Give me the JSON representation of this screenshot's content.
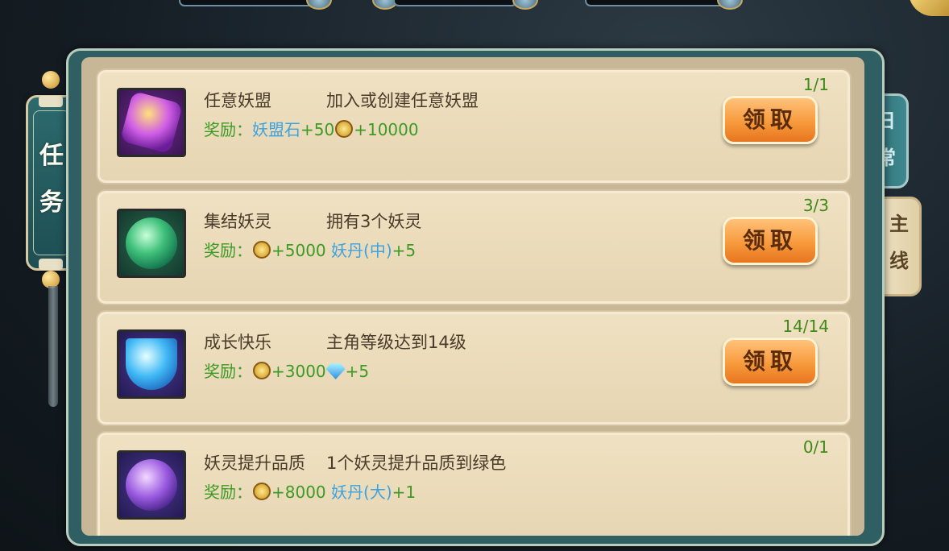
{
  "side_tag": {
    "label": "任务"
  },
  "tabs": [
    {
      "label_1": "日",
      "label_2": "常",
      "selected": false
    },
    {
      "label_1": "主",
      "label_2": "线",
      "selected": true
    }
  ],
  "quests": [
    {
      "name": "任意妖盟",
      "desc": "加入或创建任意妖盟",
      "progress": "1/1",
      "reward_label": "奖励：",
      "reward_item": "妖盟石",
      "reward_item_amount": "+50",
      "reward_coin": "+10000",
      "button": "领取",
      "icon": "yaomeng-stone-icon"
    },
    {
      "name": "集结妖灵",
      "desc": "拥有3个妖灵",
      "progress": "3/3",
      "reward_label": "奖励：",
      "reward_coin": "+5000",
      "reward_item": "妖丹(中)",
      "reward_item_amount": "+5",
      "button": "领取",
      "icon": "green-orb-icon"
    },
    {
      "name": "成长快乐",
      "desc": "主角等级达到14级",
      "progress": "14/14",
      "reward_label": "奖励：",
      "reward_coin": "+3000",
      "reward_gem": "+5",
      "button": "领取",
      "icon": "diamond-icon"
    },
    {
      "name": "妖灵提升品质",
      "desc": "1个妖灵提升品质到绿色",
      "progress": "0/1",
      "reward_label": "奖励：",
      "reward_coin": "+8000",
      "reward_item": "妖丹(大)",
      "reward_item_amount": "+1",
      "icon": "purple-orb-icon"
    }
  ]
}
